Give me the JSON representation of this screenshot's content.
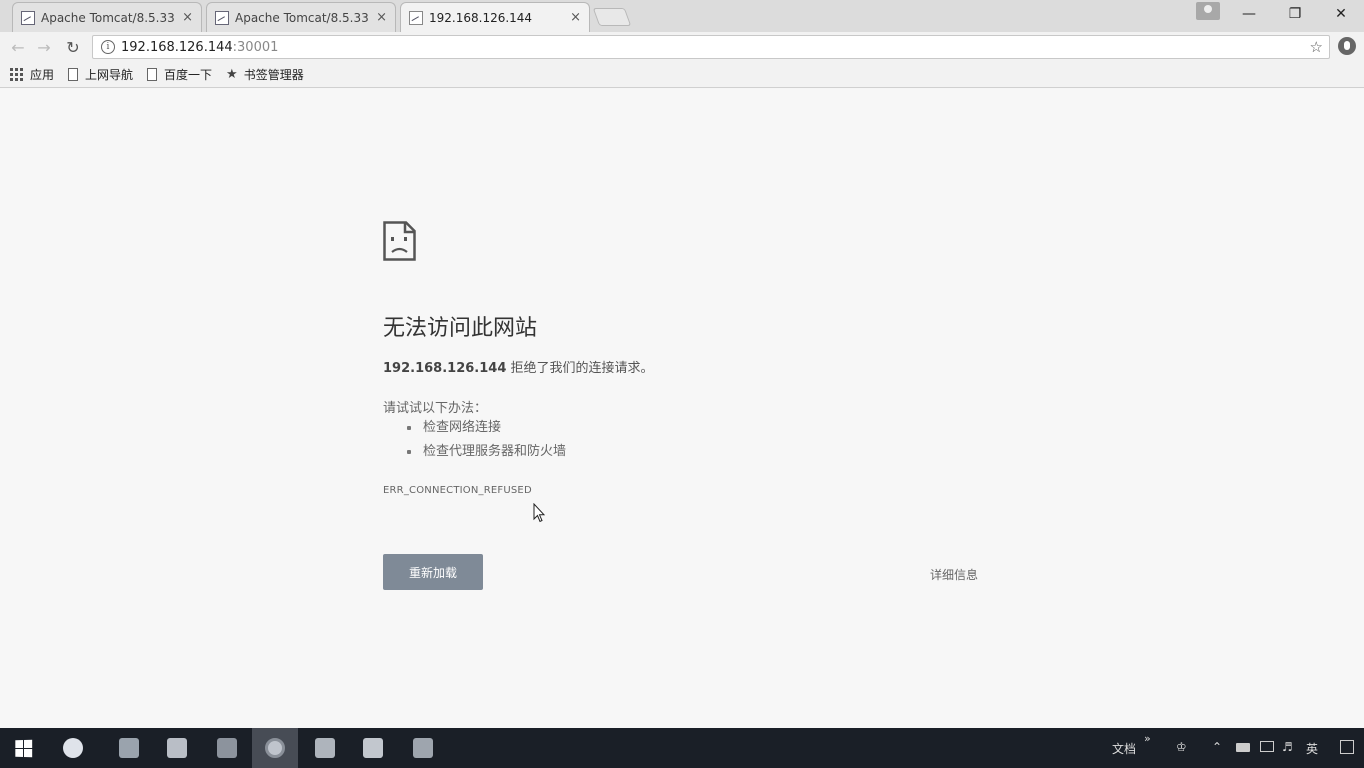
{
  "browser": {
    "tabs": [
      {
        "title": "Apache Tomcat/8.5.33",
        "active": false
      },
      {
        "title": "Apache Tomcat/8.5.33",
        "active": false
      },
      {
        "title": "192.168.126.144",
        "active": true
      }
    ],
    "close_glyph": "×",
    "address_bar": {
      "host": "192.168.126.144",
      "port": ":30001"
    },
    "window_controls": {
      "minimize": "—",
      "maximize": "❐",
      "close": "✕"
    }
  },
  "bookmarks": [
    {
      "label": "应用",
      "icon": "apps-icon"
    },
    {
      "label": "上网导航",
      "icon": "page-icon"
    },
    {
      "label": "百度一下",
      "icon": "page-icon"
    },
    {
      "label": "书签管理器",
      "icon": "star-icon"
    }
  ],
  "error_page": {
    "title": "无法访问此网站",
    "host": "192.168.126.144",
    "description_suffix": " 拒绝了我们的连接请求。",
    "suggestions_heading": "请试试以下办法：",
    "suggestions": [
      "检查网络连接",
      "检查代理服务器和防火墙"
    ],
    "error_code": "ERR_CONNECTION_REFUSED",
    "reload_label": "重新加载",
    "details_label": "详细信息"
  },
  "taskbar": {
    "tray": {
      "docs_label": "文档",
      "chevron": "»",
      "ime_label": "英"
    }
  },
  "colors": {
    "reload_button": "#7f8a97",
    "taskbar": "#1a1f27",
    "page_background": "#f7f7f7"
  }
}
